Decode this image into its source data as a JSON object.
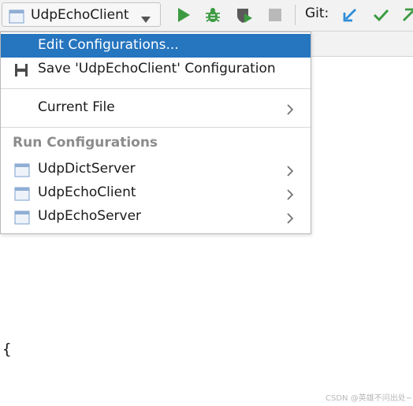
{
  "toolbar": {
    "run_config": "UdpEchoClient",
    "git_label": "Git:",
    "icons": [
      "window-icon",
      "chevron-down-icon",
      "run-icon",
      "debug-icon",
      "coverage-icon",
      "stop-icon",
      "update-project-icon",
      "commit-icon",
      "push-icon"
    ]
  },
  "menu": {
    "edit_configurations": "Edit Configurations...",
    "save_configuration": "Save 'UdpEchoClient' Configuration",
    "current_file": "Current File",
    "run_configurations_header": "Run Configurations",
    "configurations": [
      {
        "label": "UdpDictServer"
      },
      {
        "label": "UdpEchoClient"
      },
      {
        "label": "UdpEchoServer"
      }
    ]
  },
  "editor": {
    "code_fragment": "{"
  },
  "watermark": "CSDN @英雄不问出处~",
  "colors": {
    "selection": "#2675bf",
    "run_green": "#3c9b42",
    "vcs_blue": "#2e8dd8",
    "disabled_gray": "#b9b9b9"
  }
}
